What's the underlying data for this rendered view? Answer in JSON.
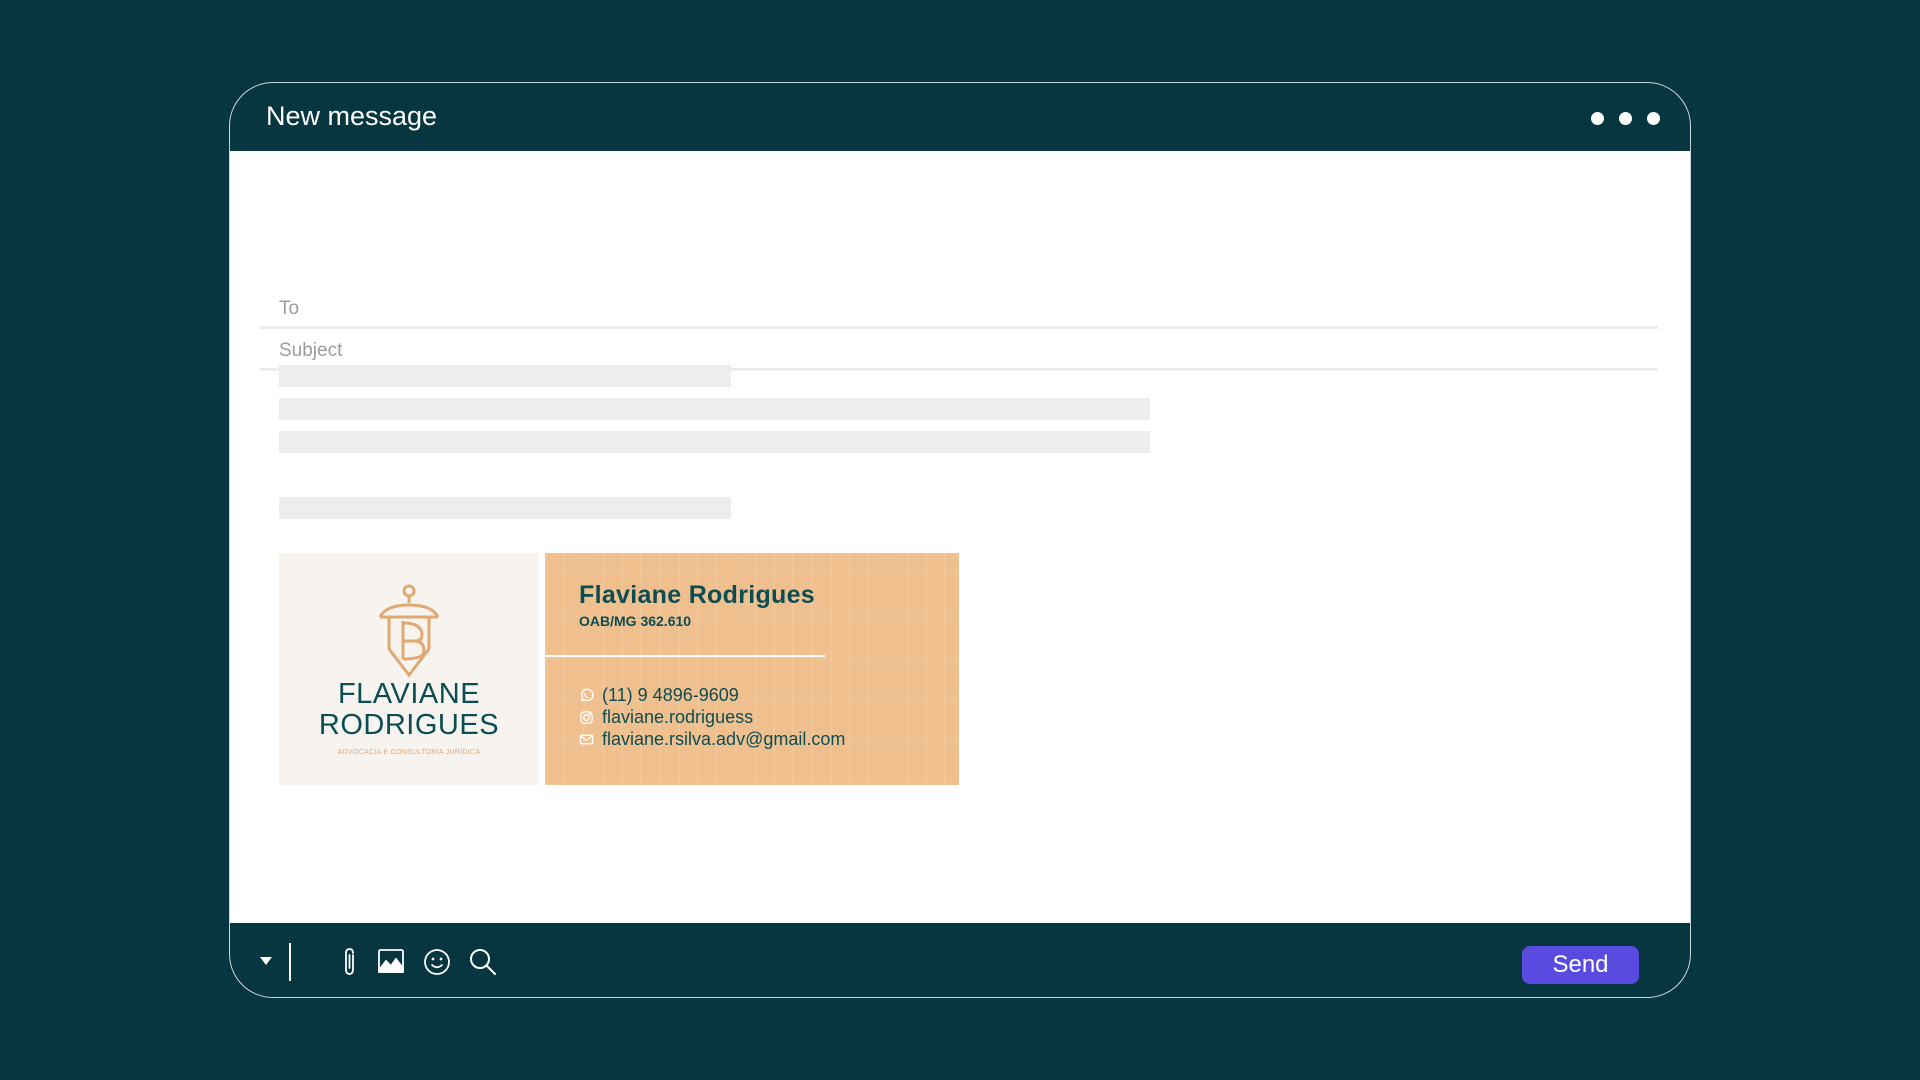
{
  "compose": {
    "title": "New message",
    "to_placeholder": "To",
    "subject_placeholder": "Subject"
  },
  "signature": {
    "brand_line1": "FLAVIANE",
    "brand_line2": "RODRIGUES",
    "tagline": "ADVOCACIA E CONSULTORIA JURÍDICA",
    "name": "Flaviane Rodrigues",
    "registration": "OAB/MG 362.610",
    "phone": "(11) 9 4896-9609",
    "instagram": "flaviane.rodriguess",
    "email": "flaviane.rsilva.adv@gmail.com"
  },
  "toolbar": {
    "icons": [
      "caret-down-icon",
      "paperclip-icon",
      "image-icon",
      "emoji-icon",
      "search-icon"
    ],
    "send_label": "Send"
  },
  "colors": {
    "background": "#073640",
    "brand_teal": "#0c4d53",
    "signature_tan": "#efbf8e",
    "logo_gold": "#e0a873",
    "send_button": "#5a4be0"
  }
}
